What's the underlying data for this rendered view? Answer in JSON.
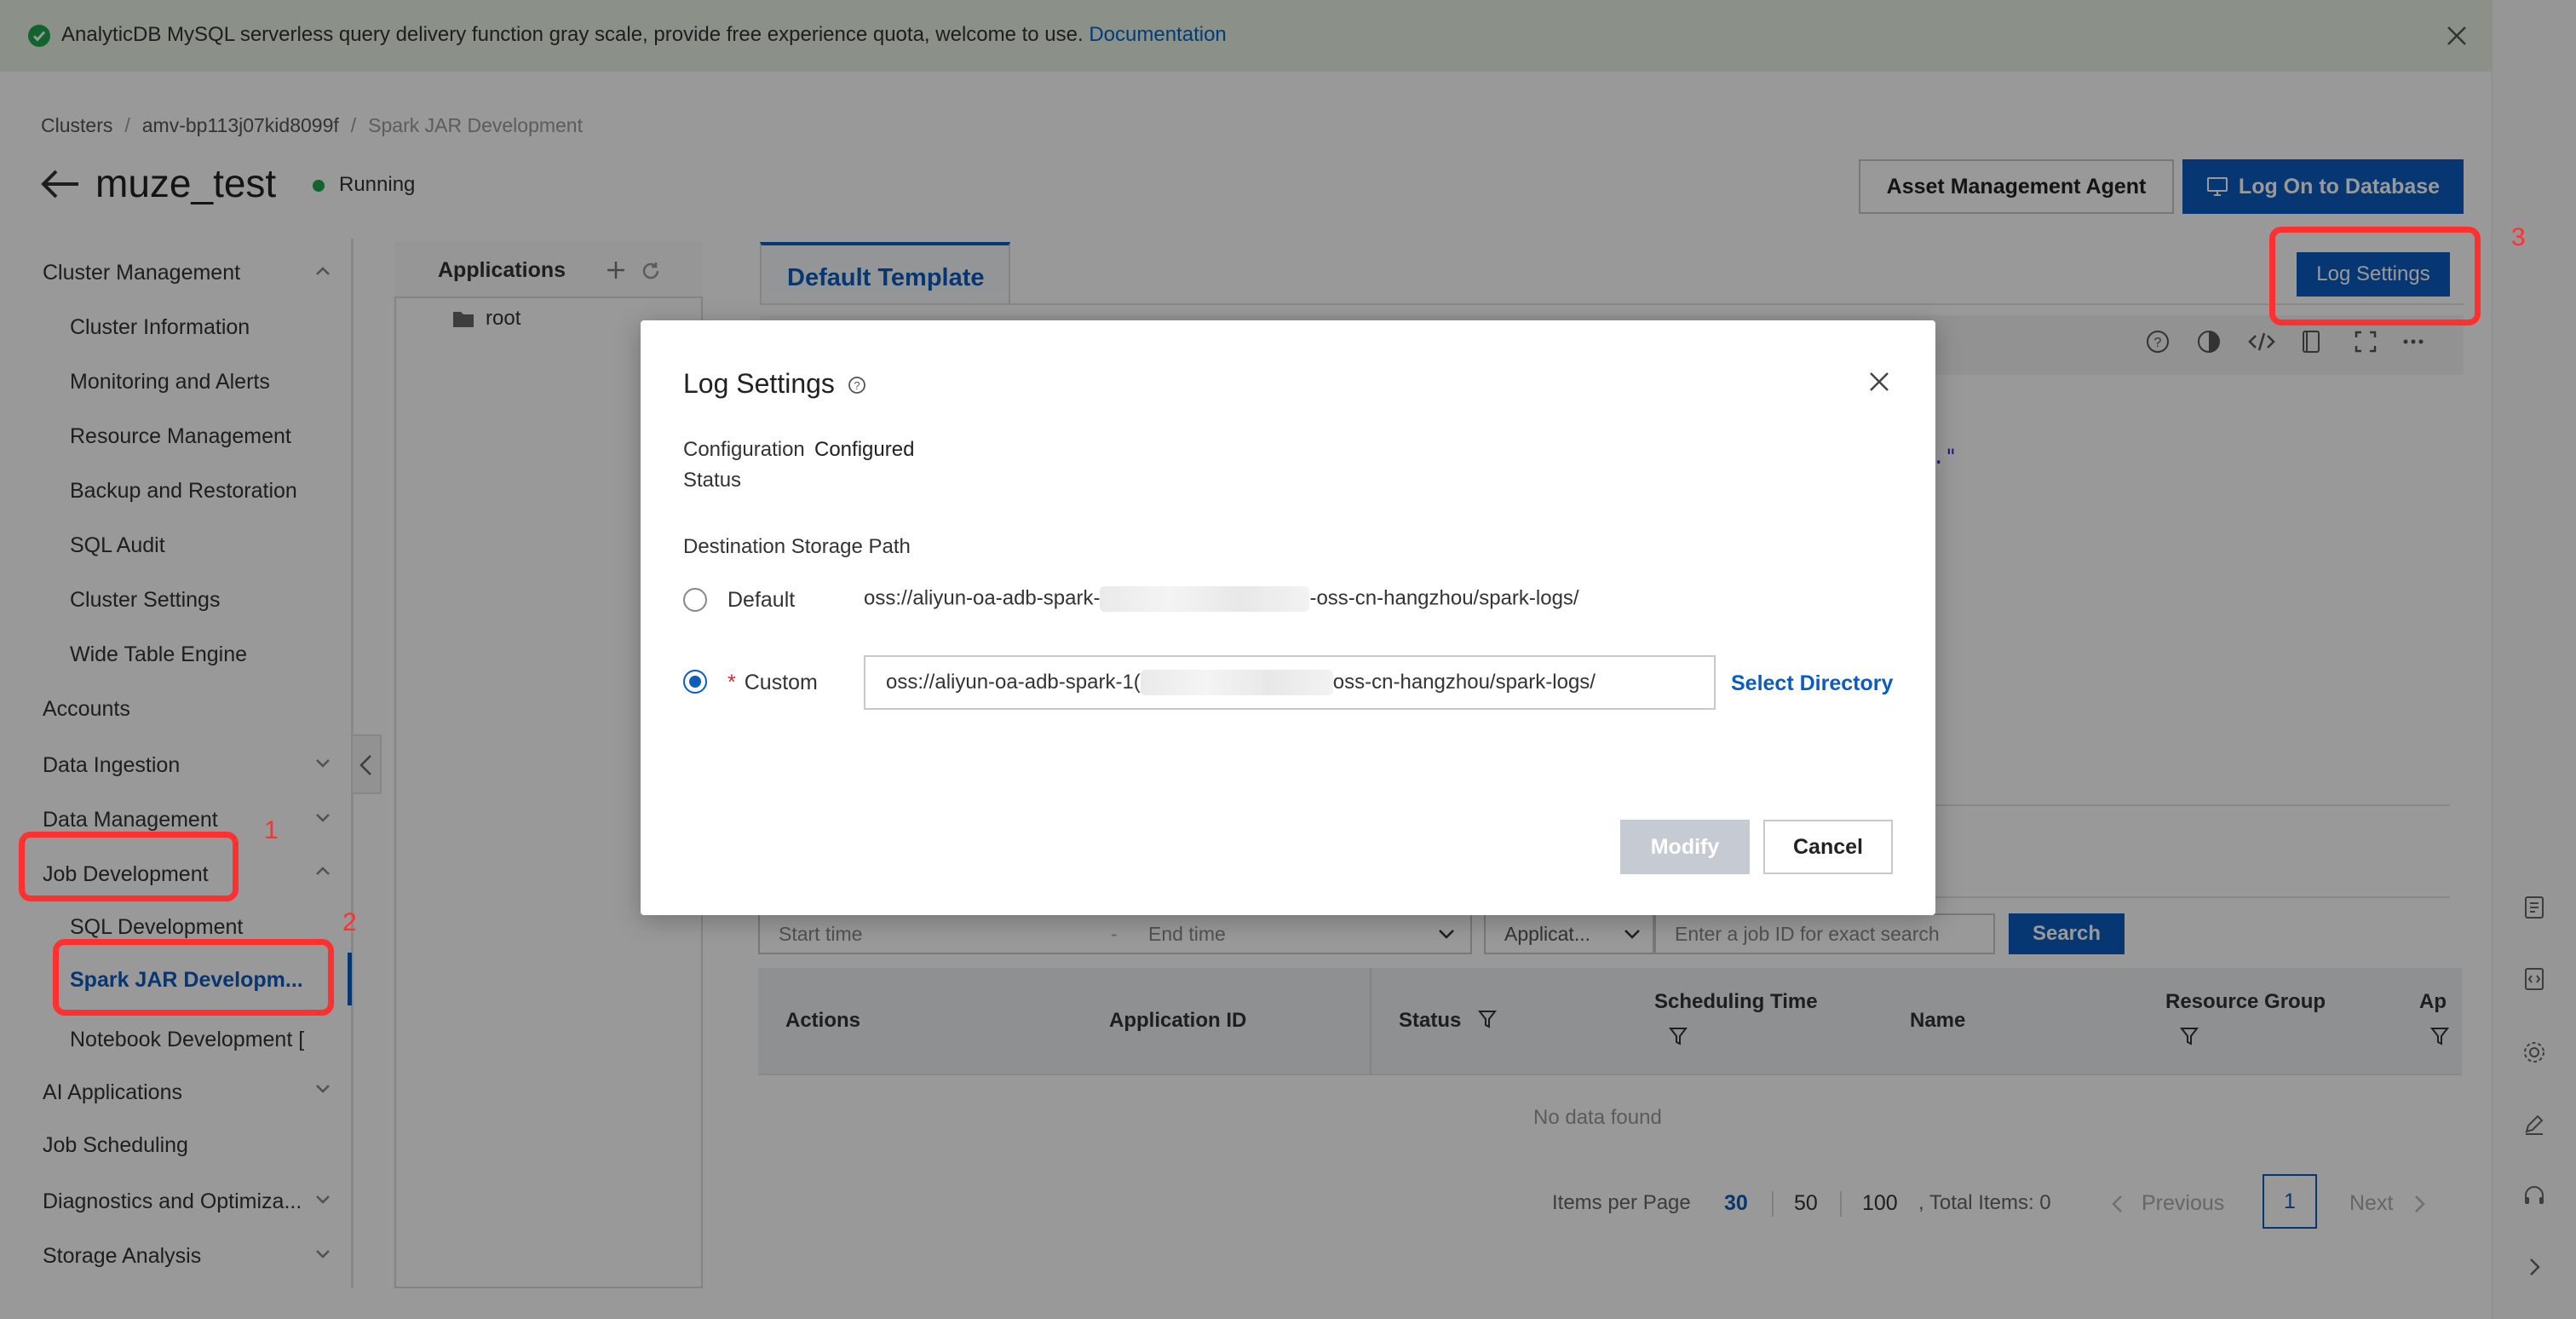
{
  "banner": {
    "message": "AnalyticDB MySQL serverless query delivery function gray scale, provide free experience quota, welcome to use.",
    "link": "Documentation"
  },
  "breadcrumb": {
    "items": [
      "Clusters",
      "amv-bp113j07kid8099f",
      "Spark JAR Development"
    ]
  },
  "header": {
    "title": "muze_test",
    "status": "Running",
    "asset_button": "Asset Management Agent",
    "logon_button": "Log On to Database"
  },
  "sidebar": {
    "cluster_management": "Cluster Management",
    "cluster_information": "Cluster Information",
    "monitoring_alerts": "Monitoring and Alerts",
    "resource_management": "Resource Management",
    "backup_restoration": "Backup and Restoration",
    "sql_audit": "SQL Audit",
    "cluster_settings": "Cluster Settings",
    "wide_table_engine": "Wide Table Engine",
    "accounts": "Accounts",
    "data_ingestion": "Data Ingestion",
    "data_management": "Data Management",
    "job_development": "Job Development",
    "sql_development": "SQL Development",
    "spark_jar_development": "Spark JAR Developm...",
    "notebook_development": "Notebook Development [",
    "ai_applications": "AI Applications",
    "job_scheduling": "Job Scheduling",
    "diagnostics": "Diagnostics and Optimiza...",
    "storage_analysis": "Storage Analysis"
  },
  "applications": {
    "title": "Applications",
    "root": "root"
  },
  "template": {
    "tab": "Default Template",
    "log_settings_button": "Log Settings",
    "code_fragment": "m.\""
  },
  "filters": {
    "start_placeholder": "Start time",
    "dash": "-",
    "end_placeholder": "End time",
    "app_select": "Applicat...",
    "job_placeholder": "Enter a job ID for exact search",
    "search_button": "Search"
  },
  "table": {
    "columns": [
      "Actions",
      "Application ID",
      "Status",
      "Scheduling Time",
      "Name",
      "Resource Group",
      "Ap"
    ],
    "empty": "No data found"
  },
  "pagination": {
    "items_per_page": "Items per Page",
    "sizes": [
      "30",
      "50",
      "100"
    ],
    "selected_size": "30",
    "total": ", Total Items: 0",
    "previous": "Previous",
    "current_page": "1",
    "next": "Next"
  },
  "modal": {
    "title": "Log Settings",
    "config_status_label": "Configuration Status",
    "config_status_value": "Configured",
    "destination_label": "Destination Storage Path",
    "default_label": "Default",
    "default_path_prefix": "oss://aliyun-oa-adb-spark-",
    "default_path_suffix": "-oss-cn-hangzhou/spark-logs/",
    "custom_label": "Custom",
    "custom_path_prefix": "oss://aliyun-oa-adb-spark-1(",
    "custom_path_suffix": "oss-cn-hangzhou/spark-logs/",
    "select_directory": "Select Directory",
    "modify_button": "Modify",
    "cancel_button": "Cancel"
  },
  "annotations": {
    "one": "1",
    "two": "2",
    "three": "3",
    "color": "#ff3030"
  },
  "colors": {
    "primary": "#0b5cbf",
    "success": "#1ea54b",
    "banner_bg": "#e8f2e4"
  }
}
